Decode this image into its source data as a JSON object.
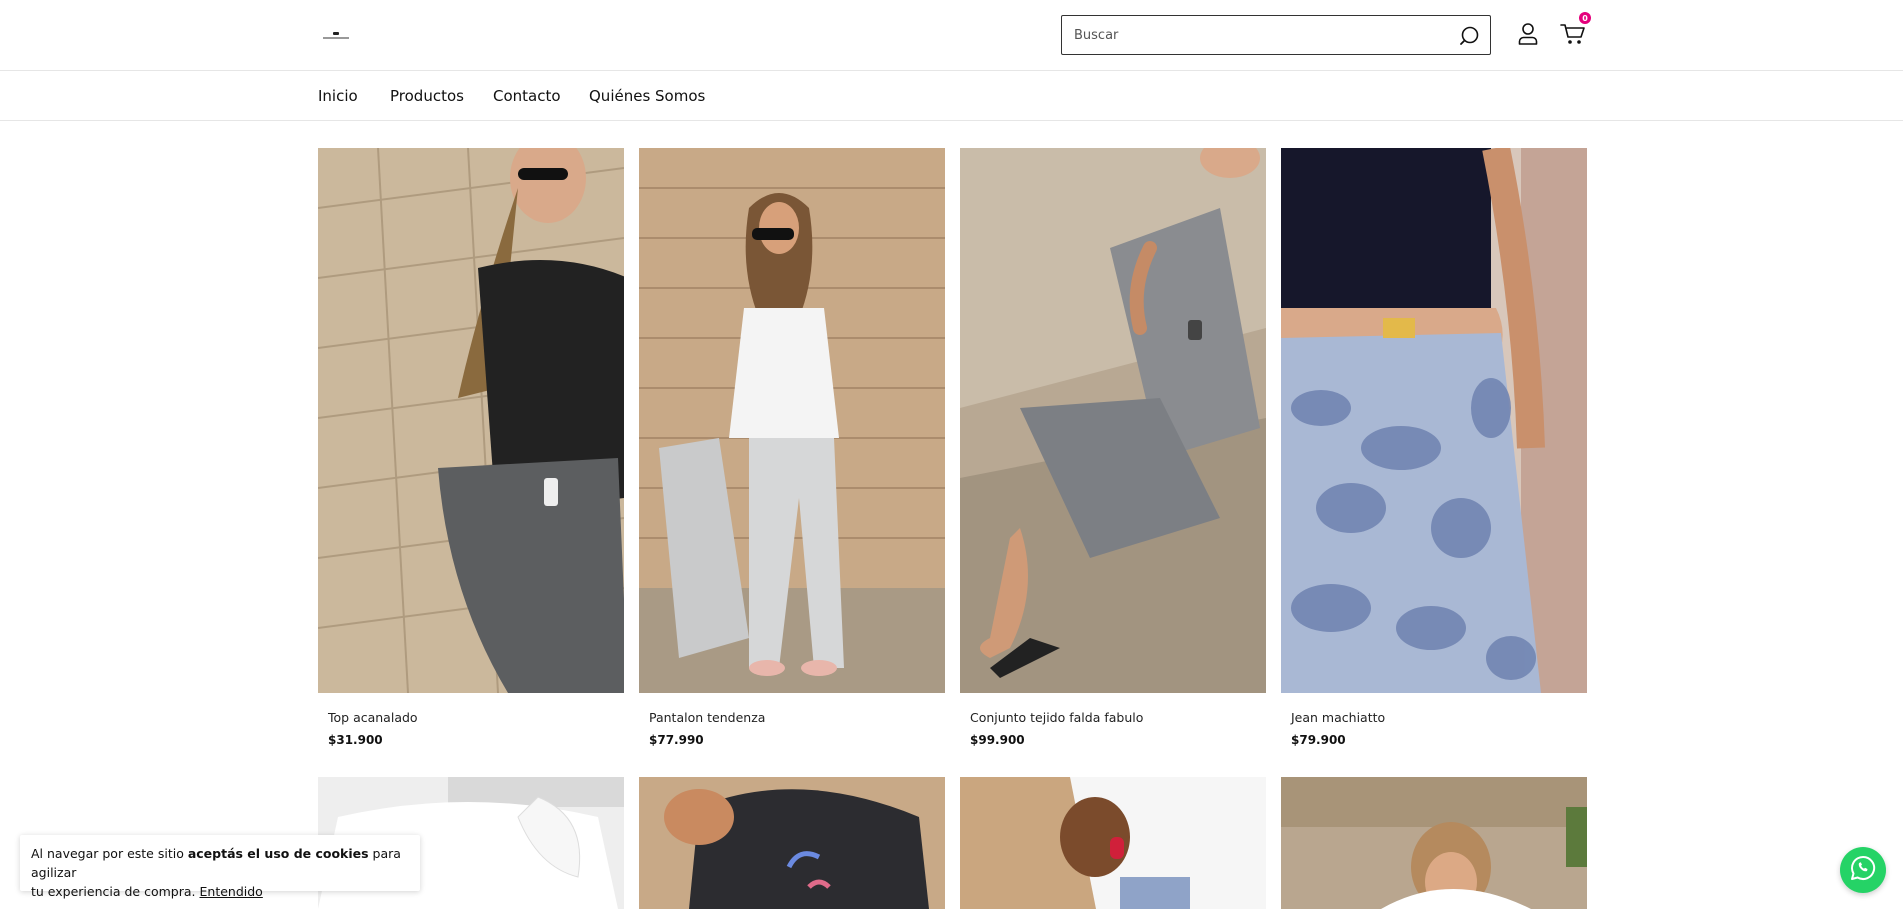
{
  "header": {
    "search_placeholder": "Buscar",
    "cart_count": "0"
  },
  "nav": {
    "items": [
      {
        "label": "Inicio"
      },
      {
        "label": "Productos"
      },
      {
        "label": "Contacto"
      },
      {
        "label": "Quiénes Somos"
      }
    ]
  },
  "products": [
    {
      "name": "Top acanalado",
      "price": "$31.900"
    },
    {
      "name": "Pantalon tendenza",
      "price": "$77.990"
    },
    {
      "name": "Conjunto tejido falda fabulo",
      "price": "$99.900"
    },
    {
      "name": "Jean machiatto",
      "price": "$79.900"
    }
  ],
  "cookie_banner": {
    "text_before": "Al navegar por este sitio ",
    "text_bold": "aceptás el uso de cookies",
    "text_after_1": " para agilizar",
    "text_after_2": "tu experiencia de compra.",
    "accept_label": "Entendido"
  },
  "colors": {
    "accent_badge": "#e4007c",
    "whatsapp": "#25d366"
  }
}
